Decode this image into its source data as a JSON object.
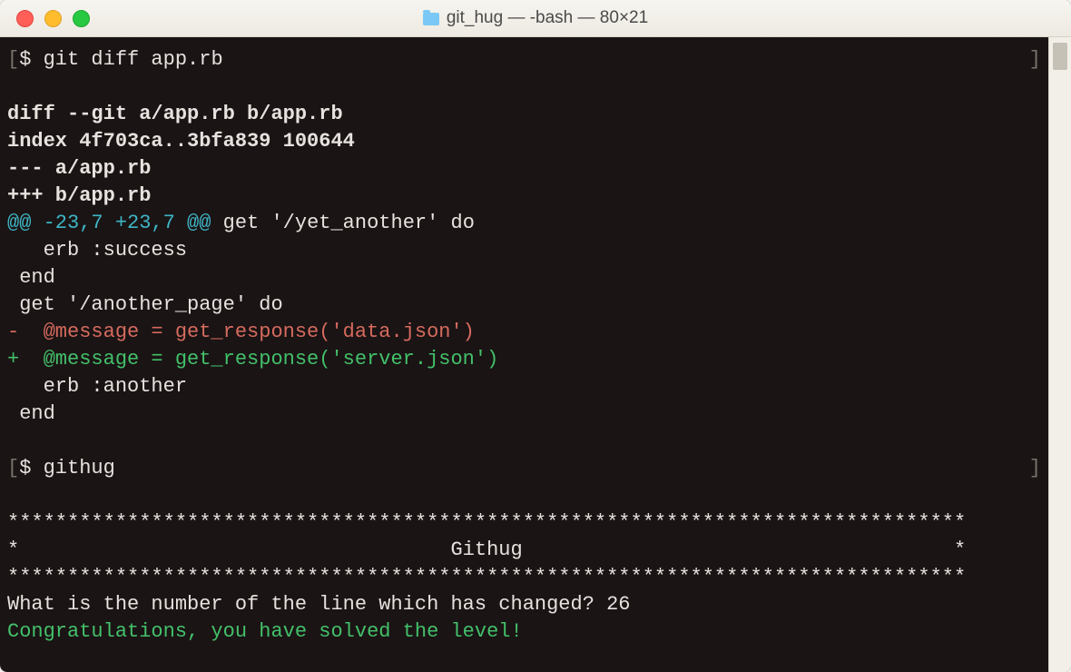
{
  "window": {
    "title": "git_hug — -bash — 80×21",
    "folder_icon": "folder-icon"
  },
  "traffic": {
    "close": "close",
    "minimize": "minimize",
    "maximize": "maximize"
  },
  "scrollbar": {
    "thumb": "thumb"
  },
  "terminal": {
    "prompt1": {
      "left_bracket": "[",
      "sigil": "$ ",
      "command": "git diff app.rb",
      "right_bracket": "]"
    },
    "diff": {
      "header1": "diff --git a/app.rb b/app.rb",
      "header2": "index 4f703ca..3bfa839 100644",
      "header3": "--- a/app.rb",
      "header4": "+++ b/app.rb",
      "hunk_prefix": "@@ ",
      "hunk_del": "-23,7 ",
      "hunk_add": "+23,7 ",
      "hunk_mid": "@@",
      "hunk_tail": " get '/yet_another' do",
      "ctx1": "   erb :success",
      "ctx2": " end",
      "ctx3": " get '/another_page' do",
      "del": "-  @message = get_response('data.json')",
      "add": "+  @message = get_response('server.json')",
      "ctx4": "   erb :another",
      "ctx5": " end"
    },
    "blank": "",
    "prompt2": {
      "left_bracket": "[",
      "sigil": "$ ",
      "command": "githug",
      "right_bracket": "]"
    },
    "githug": {
      "stars_top": "********************************************************************************",
      "banner": "*                                    Githug                                    *",
      "stars_bottom": "********************************************************************************",
      "question": "What is the number of the line which has changed? 26",
      "congrats": "Congratulations, you have solved the level!"
    }
  }
}
